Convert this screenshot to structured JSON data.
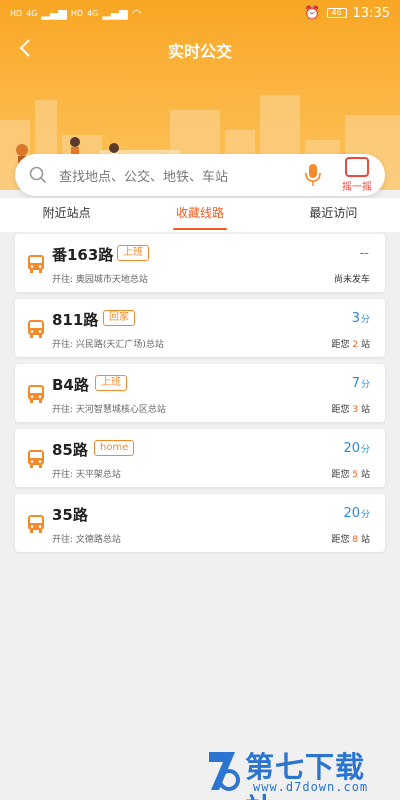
{
  "status_bar": {
    "time": "13:35",
    "net_1": "HD",
    "net_2": "HD",
    "sig_1": "4G",
    "sig_2": "4G",
    "battery": "46"
  },
  "header": {
    "back_icon": "chevron-left-icon",
    "title": "实时公交"
  },
  "search": {
    "placeholder": "查找地点、公交、地铁、车站",
    "shake_label": "摇一摇"
  },
  "tabs": [
    {
      "label": "附近站点",
      "active": false
    },
    {
      "label": "收藏线路",
      "active": true
    },
    {
      "label": "最近访问",
      "active": false
    }
  ],
  "routes": [
    {
      "name": "番163路",
      "tag": "上班",
      "dest": "开往: 奥园城市天地总站",
      "eta": "--",
      "eta_unit": "",
      "status_pre": "尚未发车",
      "stops": "",
      "status_post": ""
    },
    {
      "name": "811路",
      "tag": "回家",
      "dest": "开往: 兴民路(天汇广场)总站",
      "eta": "3",
      "eta_unit": "分",
      "status_pre": "距您",
      "stops": "2",
      "status_post": "站"
    },
    {
      "name": "B4路",
      "tag": "上班",
      "dest": "开往: 天河智慧城核心区总站",
      "eta": "7",
      "eta_unit": "分",
      "status_pre": "距您",
      "stops": "3",
      "status_post": "站"
    },
    {
      "name": "85路",
      "tag": "home",
      "dest": "开往: 天平架总站",
      "eta": "20",
      "eta_unit": "分",
      "status_pre": "距您",
      "stops": "5",
      "status_post": "站"
    },
    {
      "name": "35路",
      "tag": "",
      "dest": "开往: 文德路总站",
      "eta": "20",
      "eta_unit": "分",
      "status_pre": "距您",
      "stops": "8",
      "status_post": "站"
    }
  ],
  "watermark": {
    "text": "第七下载站",
    "url": "www.d7down.com"
  },
  "colors": {
    "header_orange": "#f8a623",
    "accent": "#f25c1e",
    "eta_blue": "#2e89d8",
    "tag_orange": "#f58a2b",
    "watermark_blue": "#2b74d0"
  }
}
